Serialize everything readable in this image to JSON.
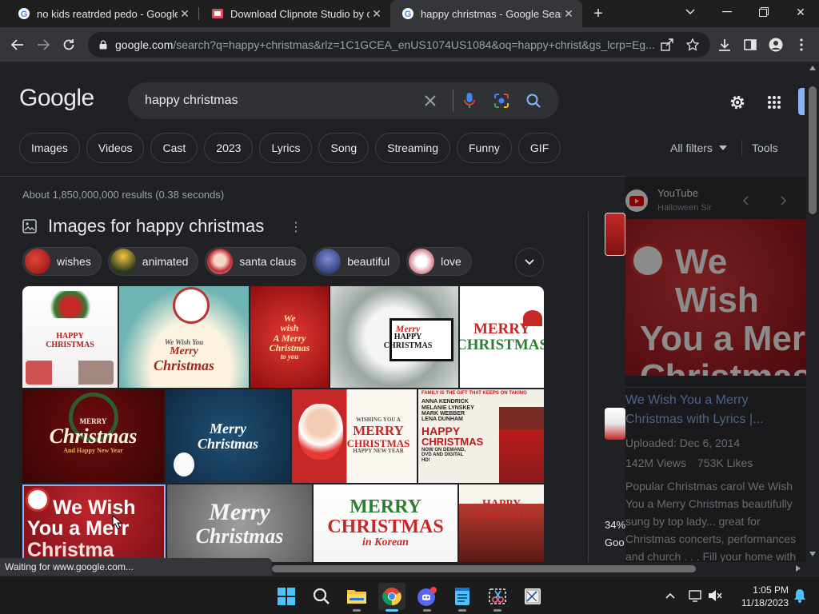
{
  "browser": {
    "tabs": [
      {
        "title": "no kids reatrded pedo - Google"
      },
      {
        "title": "Download Clipnote Studio by ca"
      },
      {
        "title": "happy christmas - Google Searcl"
      }
    ],
    "url_domain": "google.com",
    "url_rest": "/search?q=happy+christmas&rlz=1C1GCEA_enUS1074US1084&oq=happy+christ&gs_lcrp=Eg..."
  },
  "google": {
    "logo": "Google",
    "query": "happy christmas",
    "chips": [
      "Images",
      "Videos",
      "Cast",
      "2023",
      "Lyrics",
      "Song",
      "Streaming",
      "Funny",
      "GIF"
    ],
    "all_filters": "All filters",
    "tools": "Tools",
    "stats": "About 1,850,000,000 results (0.38 seconds)",
    "images_header": "Images for happy christmas",
    "subchips": [
      "wishes",
      "animated",
      "santa claus",
      "beautiful",
      "love"
    ]
  },
  "tiles": [
    {
      "line1": "HAPPY",
      "line2": "CHRISTMAS"
    },
    {
      "line1": "We Wish You",
      "line2": "Merry",
      "line3": "Christmas"
    },
    {
      "line1": "We",
      "line2": "wish",
      "line3": "A Merry",
      "line4": "Christmas",
      "line5": "to you"
    },
    {
      "line1": "Merry",
      "line2": "HAPPY",
      "line3": "CHRISTMAS"
    },
    {
      "line1": "MERRY",
      "line2": "CHRISTMAS"
    },
    {
      "line1": "MERRY",
      "line2": "Christmas",
      "line3": "And Happy New Year"
    },
    {
      "line1": "Merry",
      "line2": "Christmas"
    },
    {
      "line1": "WISHING YOU A",
      "line2": "MERRY",
      "line3": "CHRISTMAS",
      "line4": "HAPPY NEW YEAR"
    },
    {
      "line1": "FAMILY IS THE GIFT THAT KEEPS ON TAKING",
      "line2": "ANNA KENDRICK",
      "line3": "MELANIE LYNSKEY",
      "line4": "MARK WEBBER",
      "line5": "LENA DUNHAM",
      "line6": "HAPPY",
      "line7": "CHRISTMAS",
      "line8": "NOW ON DEMAND, DVD AND DIGITAL HD!"
    },
    {
      "line1": "We Wish",
      "line2": "You a Merr",
      "line3": "Christma"
    },
    {
      "line1": "Merry",
      "line2": "Christmas"
    },
    {
      "line1": "MERRY",
      "line2": "CHRISTMAS",
      "line3": "in Korean"
    },
    {
      "line1": "HAPPY",
      "line2": "CHRISTMAS"
    }
  ],
  "right_panel": {
    "source": "YouTube",
    "source_sub": "Halloween Sir",
    "thumb_line1": "We Wish",
    "thumb_line2": "You a Mer",
    "thumb_line3": "Christmas",
    "title": "We Wish You a Merry Christmas with Lyrics |...",
    "uploaded": "Uploaded: Dec 6, 2014",
    "views": "142M Views",
    "likes": "753K Likes",
    "desc": "Popular Christmas carol We Wish You a Merry Christmas beautifully sung by top lady... great for Christmas concerts, performances and church . . . Fill your home with the Christmas ...",
    "side_pct": "34%",
    "side_txt": "Goo"
  },
  "status": "Waiting for www.google.com...",
  "clock": {
    "time": "1:05 PM",
    "date": "11/18/2023"
  },
  "colors": {
    "bg": "#202124",
    "accent": "#8ab4f8",
    "chrome": "#35363a"
  }
}
